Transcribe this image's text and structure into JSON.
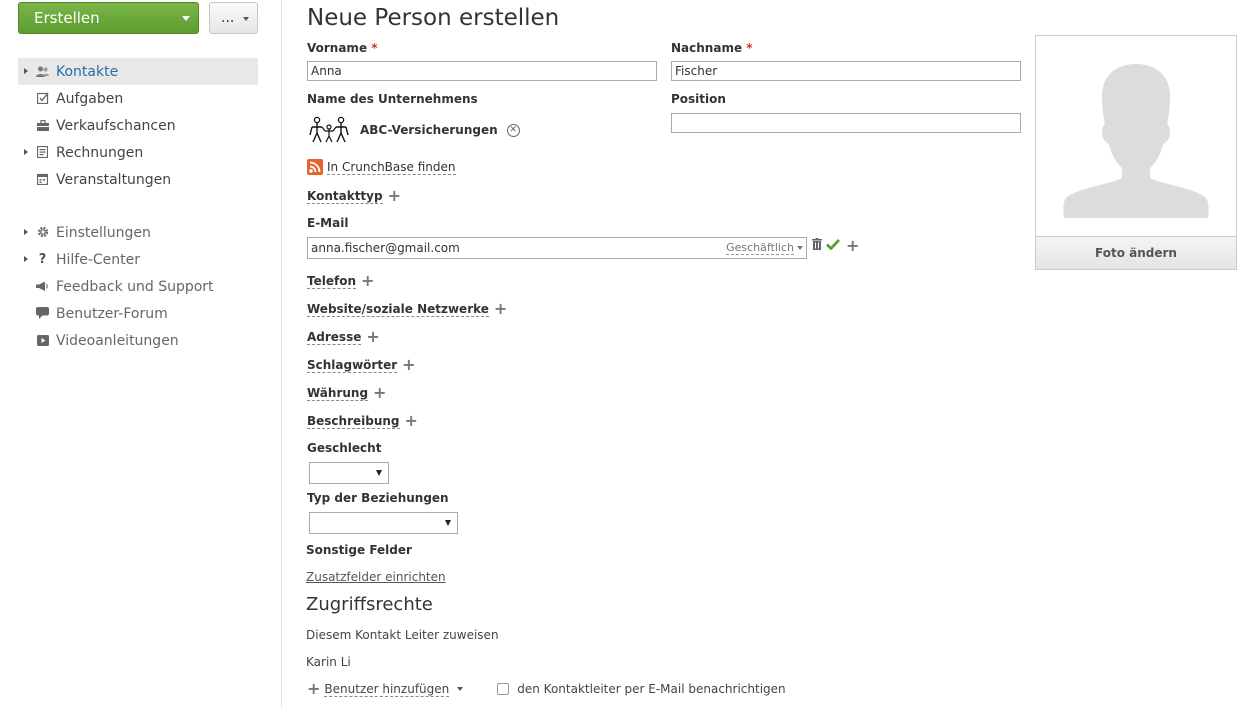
{
  "sidebar": {
    "create_label": "Erstellen",
    "more_label": "...",
    "nav": [
      {
        "label": "Kontakte",
        "icon": "contacts-icon"
      },
      {
        "label": "Aufgaben",
        "icon": "tasks-icon"
      },
      {
        "label": "Verkaufschancen",
        "icon": "opportunities-icon"
      },
      {
        "label": "Rechnungen",
        "icon": "invoices-icon"
      },
      {
        "label": "Veranstaltungen",
        "icon": "events-icon"
      }
    ],
    "secondary": [
      {
        "label": "Einstellungen",
        "icon": "gear-icon"
      },
      {
        "label": "Hilfe-Center",
        "icon": "question-icon"
      },
      {
        "label": "Feedback und Support",
        "icon": "megaphone-icon"
      },
      {
        "label": "Benutzer-Forum",
        "icon": "speech-bubble-icon"
      },
      {
        "label": "Videoanleitungen",
        "icon": "video-icon"
      }
    ]
  },
  "form": {
    "title": "Neue Person erstellen",
    "firstname_label": "Vorname",
    "firstname_value": "Anna",
    "lastname_label": "Nachname",
    "lastname_value": "Fischer",
    "required_mark": "*",
    "company_label": "Name des Unternehmens",
    "company_name": "ABC-Versicherungen",
    "position_label": "Position",
    "position_value": "",
    "crunchbase_label": "In CrunchBase finden",
    "contact_type_label": "Kontakttyp",
    "email_label": "E-Mail",
    "email_value": "anna.fischer@gmail.com",
    "email_type": "Geschäftlich",
    "phone_label": "Telefon",
    "website_label": "Website/soziale Netzwerke",
    "address_label": "Adresse",
    "tags_label": "Schlagwörter",
    "currency_label": "Währung",
    "description_label": "Beschreibung",
    "gender_label": "Geschlecht",
    "gender_value": "",
    "relation_label": "Typ der Beziehungen",
    "relation_value": "",
    "other_fields_label": "Sonstige Felder",
    "setup_fields_link": "Zusatzfelder einrichten",
    "access_title": "Zugriffsrechte",
    "assign_leader_text": "Diesem Kontakt Leiter zuweisen",
    "leader_name": "Karin Li",
    "add_user_label": "Benutzer hinzufügen",
    "notify_label": "den Kontaktleiter per E-Mail benachrichtigen",
    "notify_checked": false
  },
  "photo": {
    "change_label": "Foto ändern"
  },
  "colors": {
    "create_button": "#6aaa3a",
    "link_blue": "#2d6ea8",
    "required_red": "#c0392b",
    "confirm_green": "#5aa02c"
  }
}
